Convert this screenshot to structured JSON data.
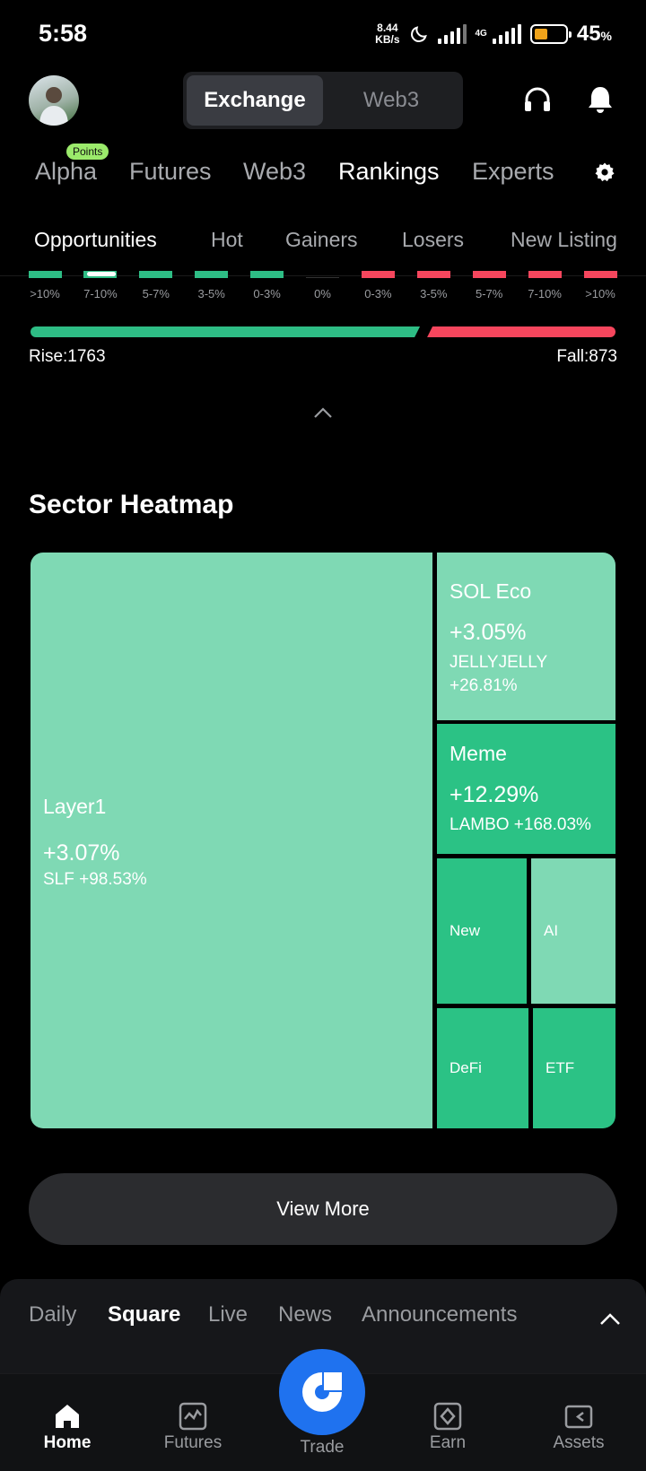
{
  "status_bar": {
    "time": "5:58",
    "net_speed_value": "8.44",
    "net_speed_unit": "KB/s",
    "lte": "4G",
    "battery_percent_value": "45",
    "battery_percent_sign": "%",
    "battery_level": 0.45,
    "battery_color": "#f0a31a"
  },
  "header": {
    "mode_tabs": [
      "Exchange",
      "Web3"
    ],
    "active_mode": "Exchange"
  },
  "main_nav": {
    "items": [
      "Alpha",
      "Futures",
      "Web3",
      "Rankings",
      "Experts"
    ],
    "active": "Rankings",
    "badge": "Points"
  },
  "sub_tabs": {
    "items": [
      "Opportunities",
      "Hot",
      "Gainers",
      "Losers",
      "New Listing"
    ],
    "active": "Opportunities"
  },
  "distribution": {
    "buckets": [
      ">10%",
      "7-10%",
      "5-7%",
      "3-5%",
      "0-3%",
      "0%",
      "0-3%",
      "3-5%",
      "5-7%",
      "7-10%",
      ">10%"
    ],
    "rise_label": "Rise:1763",
    "fall_label": "Fall:873",
    "rise": 1763,
    "fall": 873,
    "up_color": "#2ebd85",
    "down_color": "#f6465d"
  },
  "heatmap": {
    "title": "Sector Heatmap",
    "sectors": [
      {
        "name": "Layer1",
        "change": "+3.07%",
        "top": "SLF +98.53%"
      },
      {
        "name": "SOL Eco",
        "change": "+3.05%",
        "top_symbol": "JELLYJELLY",
        "top_change": "+26.81%"
      },
      {
        "name": "Meme",
        "change": "+12.29%",
        "top": "LAMBO +168.03%"
      },
      {
        "name": "New"
      },
      {
        "name": "AI"
      },
      {
        "name": "DeFi"
      },
      {
        "name": "ETF"
      }
    ],
    "light_color": "#7fd9b4",
    "dark_color": "#2bc285"
  },
  "view_more": "View More",
  "feed_tabs": {
    "items": [
      "Daily",
      "Square",
      "Live",
      "News",
      "Announcements"
    ],
    "active": "Square"
  },
  "bottom_nav": {
    "items": [
      "Home",
      "Futures",
      "Trade",
      "Earn",
      "Assets"
    ],
    "active": "Home",
    "trade_color": "#1f72ef"
  }
}
